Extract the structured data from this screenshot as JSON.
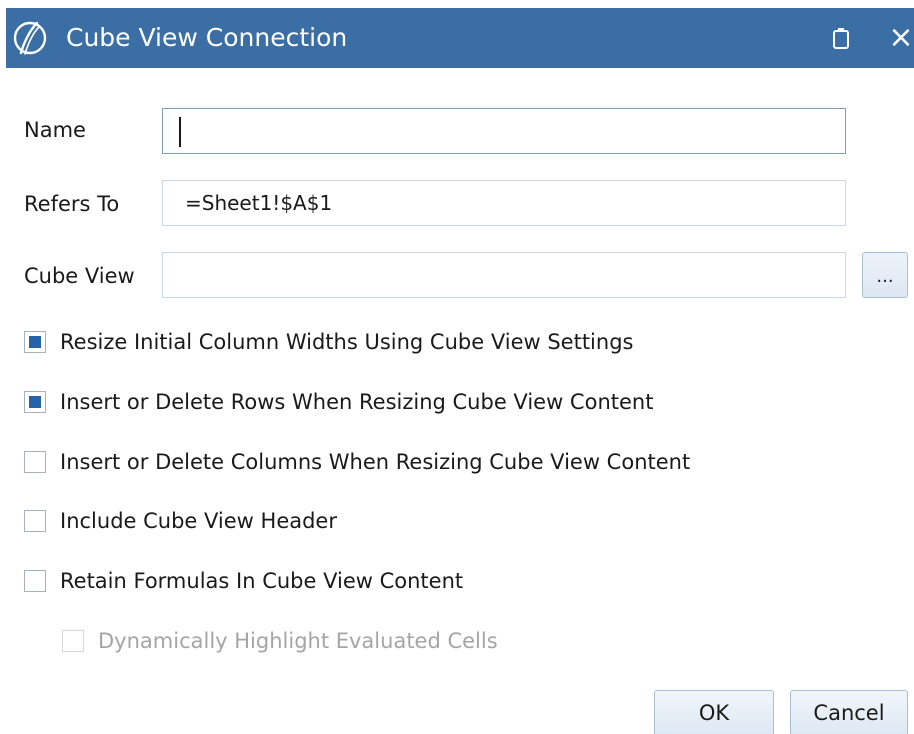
{
  "window": {
    "title": "Cube View Connection",
    "title_bar_color": "#3a6ea5",
    "logo_icon": "onestream-logo-icon",
    "restore_icon": "restore-icon",
    "close_glyph": "×"
  },
  "form": {
    "name_label": "Name",
    "name_value": "",
    "refers_to_label": "Refers To",
    "refers_to_value": "=Sheet1!$A$1",
    "cube_view_label": "Cube View",
    "cube_view_value": "",
    "browse_label": "..."
  },
  "options": [
    {
      "label": "Resize Initial Column Widths Using Cube View Settings",
      "checked": true,
      "enabled": true
    },
    {
      "label": "Insert or Delete Rows When Resizing Cube View Content",
      "checked": true,
      "enabled": true
    },
    {
      "label": "Insert or Delete Columns When Resizing Cube View Content",
      "checked": false,
      "enabled": true
    },
    {
      "label": "Include Cube View Header",
      "checked": false,
      "enabled": true
    },
    {
      "label": "Retain Formulas In Cube View Content",
      "checked": false,
      "enabled": true
    },
    {
      "label": "Dynamically Highlight Evaluated Cells",
      "checked": false,
      "enabled": false
    }
  ],
  "buttons": {
    "ok_label": "OK",
    "cancel_label": "Cancel"
  },
  "colors": {
    "checkbox_fill": "#2563a8",
    "disabled_text": "#a5a5a5"
  }
}
